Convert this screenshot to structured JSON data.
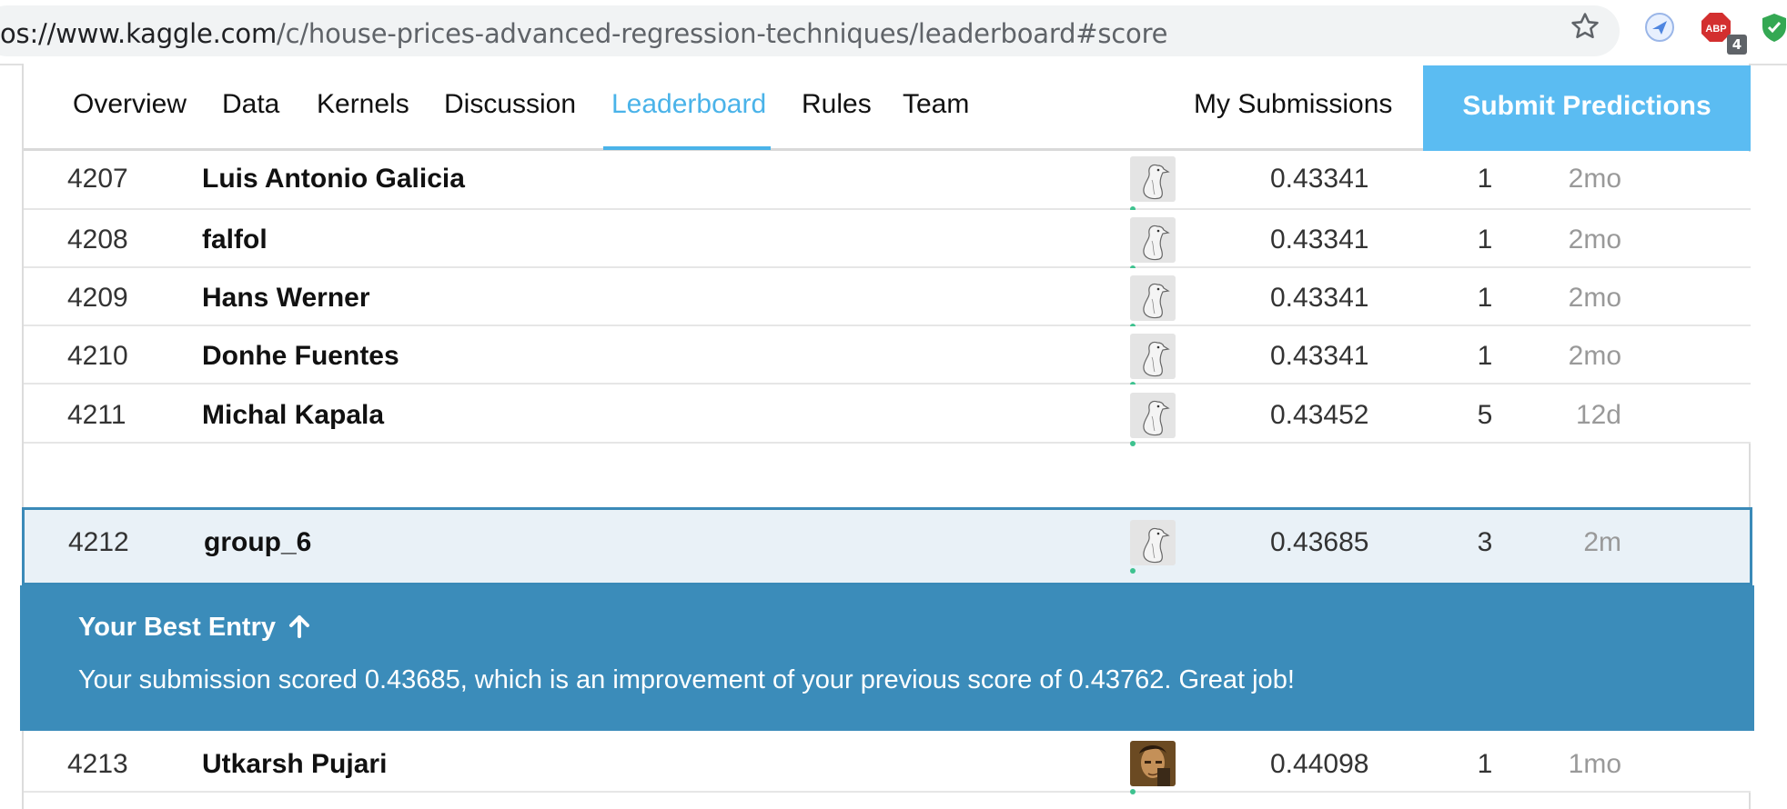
{
  "browser": {
    "url_host": "os://www.kaggle.com",
    "url_path": "/c/house-prices-advanced-regression-techniques/leaderboard#score",
    "extension_badge": "4"
  },
  "nav": {
    "tabs": [
      {
        "label": "Overview",
        "active": false
      },
      {
        "label": "Data",
        "active": false
      },
      {
        "label": "Kernels",
        "active": false
      },
      {
        "label": "Discussion",
        "active": false
      },
      {
        "label": "Leaderboard",
        "active": true
      },
      {
        "label": "Rules",
        "active": false
      },
      {
        "label": "Team",
        "active": false
      }
    ],
    "my_submissions": "My Submissions",
    "submit_predictions": "Submit Predictions"
  },
  "rows": [
    {
      "rank": "4207",
      "name": "Luis Antonio Galicia",
      "avatar": "goose-avatar",
      "score": "0.43341",
      "entries": "1",
      "last": "2mo"
    },
    {
      "rank": "4208",
      "name": "falfol",
      "avatar": "goose-avatar",
      "score": "0.43341",
      "entries": "1",
      "last": "2mo"
    },
    {
      "rank": "4209",
      "name": "Hans Werner",
      "avatar": "goose-avatar",
      "score": "0.43341",
      "entries": "1",
      "last": "2mo"
    },
    {
      "rank": "4210",
      "name": "Donhe Fuentes",
      "avatar": "goose-avatar",
      "score": "0.43341",
      "entries": "1",
      "last": "2mo"
    },
    {
      "rank": "4211",
      "name": "Michal Kapala",
      "avatar": "goose-avatar",
      "score": "0.43452",
      "entries": "5",
      "last": "12d"
    },
    {
      "rank": "4212",
      "name": "group_6",
      "avatar": "goose-avatar",
      "score": "0.43685",
      "entries": "3",
      "last": "2m"
    },
    {
      "rank": "4213",
      "name": "Utkarsh Pujari",
      "avatar": "photo-avatar",
      "score": "0.44098",
      "entries": "1",
      "last": "1mo"
    }
  ],
  "banner": {
    "title": "Your Best Entry",
    "message": "Your submission scored 0.43685, which is an improvement of your previous score of 0.43762. Great job!"
  },
  "colors": {
    "accent": "#4ab3e9",
    "submit_bg": "#5bbcf2",
    "banner_bg": "#3b8cba",
    "highlight_bg": "#e9f1f7",
    "online_dot": "#3ec28f"
  }
}
